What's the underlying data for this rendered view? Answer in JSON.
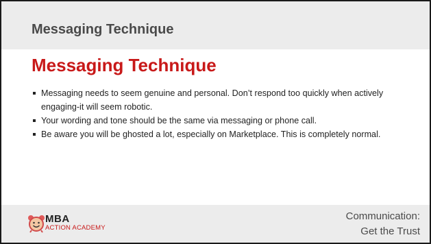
{
  "header": {
    "title": "Messaging Technique"
  },
  "content": {
    "title": "Messaging Technique",
    "bullets": [
      "Messaging needs to seem genuine and personal. Don’t respond too quickly when actively engaging-it will seem robotic.",
      "Your wording and tone should be the same via messaging or phone call.",
      "Be aware you will be ghosted a lot, especially on Marketplace. This is completely normal."
    ]
  },
  "footer": {
    "logo": {
      "mba": "MBA",
      "subtitle": "ACTION ACADEMY",
      "icon": "smiling-alarm-clock-icon"
    },
    "section_line1": "Communication:",
    "section_line2": "Get the Trust"
  },
  "colors": {
    "accent_red": "#c81919",
    "bar_gray": "#ececec",
    "text_dark": "#222222"
  }
}
